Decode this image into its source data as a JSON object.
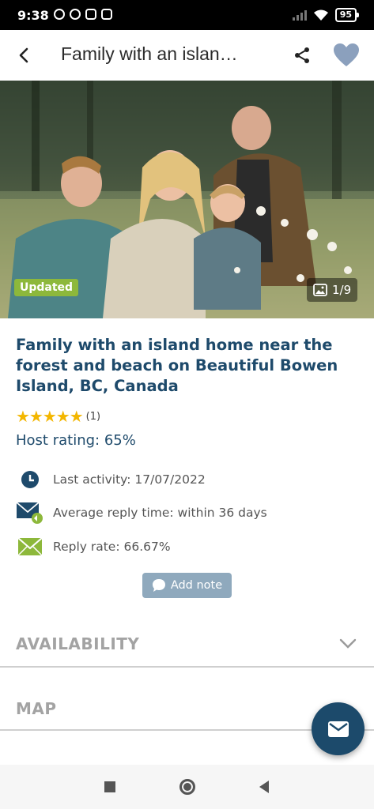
{
  "status_bar": {
    "time": "9:38",
    "battery": "95"
  },
  "app_bar": {
    "title": "Family with an islan…",
    "icons": [
      "back-arrow-icon",
      "share-icon",
      "heart-icon"
    ]
  },
  "photo": {
    "badge": "Updated",
    "counter": "1/9",
    "counter_icon": "gallery-icon"
  },
  "listing": {
    "title": "Family with an island home near the forest and beach on Beautiful Bowen Island, BC, Canada",
    "stars": "★★★★★",
    "review_count": "(1)",
    "host_rating": "Host rating: 65%"
  },
  "info": {
    "last_activity": "Last activity: 17/07/2022",
    "reply_time": "Average reply time: within 36 days",
    "reply_rate": "Reply rate: 66.67%"
  },
  "add_note_label": "Add note",
  "sections": {
    "availability": "AVAILABILITY",
    "map": "MAP"
  },
  "colors": {
    "primary": "#1e4a6b",
    "accent_green": "#8db83b",
    "star": "#f3b600",
    "muted": "#a3a3a3"
  }
}
